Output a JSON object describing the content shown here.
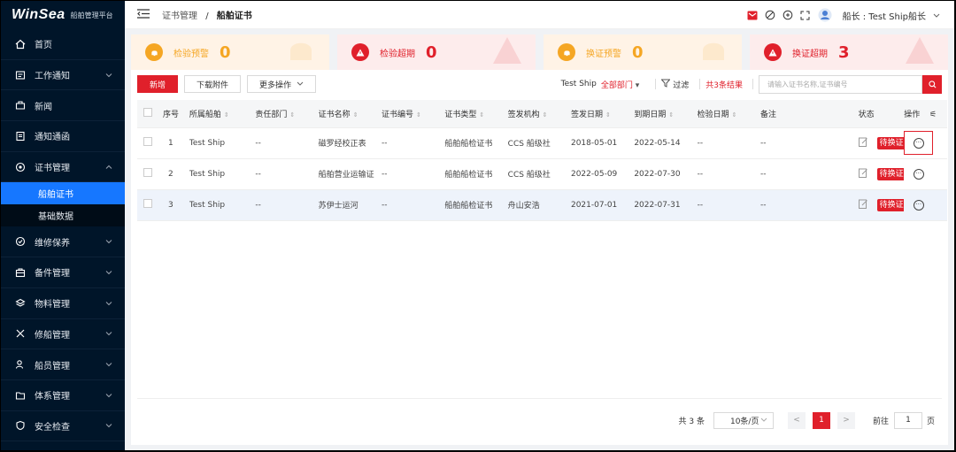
{
  "logo": {
    "brand": "WinSea",
    "subtitle": "船舶管理平台"
  },
  "sidebar": {
    "items": [
      {
        "label": "首页",
        "icon": "home-icon"
      },
      {
        "label": "工作通知",
        "icon": "notice-icon"
      },
      {
        "label": "新闻",
        "icon": "news-icon"
      },
      {
        "label": "通知通函",
        "icon": "circular-icon"
      },
      {
        "label": "证书管理",
        "icon": "certificate-icon"
      },
      {
        "label": "维修保养",
        "icon": "maintenance-icon"
      },
      {
        "label": "备件管理",
        "icon": "spare-parts-icon"
      },
      {
        "label": "物料管理",
        "icon": "material-icon"
      },
      {
        "label": "修船管理",
        "icon": "repair-icon"
      },
      {
        "label": "船员管理",
        "icon": "crew-icon"
      },
      {
        "label": "体系管理",
        "icon": "system-icon"
      },
      {
        "label": "安全检查",
        "icon": "safety-icon"
      }
    ],
    "sub": [
      {
        "label": "船舶证书"
      },
      {
        "label": "基础数据"
      }
    ]
  },
  "header": {
    "crumb_parent": "证书管理",
    "crumb_sep": "/",
    "crumb_current": "船舶证书",
    "user": "船长 : Test Ship船长"
  },
  "cards": [
    {
      "label": "检验预警",
      "value": "0",
      "color": "#f5a623"
    },
    {
      "label": "检验超期",
      "value": "0",
      "color": "#e0202b"
    },
    {
      "label": "换证预警",
      "value": "0",
      "color": "#f5a623"
    },
    {
      "label": "换证超期",
      "value": "3",
      "color": "#e0202b"
    }
  ],
  "toolbar": {
    "add": "新增",
    "download": "下载附件",
    "more": "更多操作",
    "ship": "Test Ship",
    "dept": "全部部门",
    "filter": "过滤",
    "count": "共3条结果",
    "search_placeholder": "请输入证书名称,证书编号"
  },
  "table": {
    "headers": [
      "序号",
      "所属船舶",
      "责任部门",
      "证书名称",
      "证书编号",
      "证书类型",
      "签发机构",
      "签发日期",
      "到期日期",
      "检验日期",
      "备注",
      "状态",
      "操作"
    ],
    "rows": [
      {
        "no": "1",
        "ship": "Test Ship",
        "dept": "--",
        "name": "磁罗经校正表",
        "code": "--",
        "type": "船舶船检证书",
        "org": "CCS 船级社",
        "issue": "2018-05-01",
        "expire": "2022-05-14",
        "inspect": "--",
        "remark": "--",
        "status": "待换证"
      },
      {
        "no": "2",
        "ship": "Test Ship",
        "dept": "--",
        "name": "船舶营业运输证",
        "code": "--",
        "type": "船舶船检证书",
        "org": "CCS 船级社",
        "issue": "2022-05-09",
        "expire": "2022-07-30",
        "inspect": "--",
        "remark": "--",
        "status": "待换证"
      },
      {
        "no": "3",
        "ship": "Test Ship",
        "dept": "--",
        "name": "苏伊士运河",
        "code": "--",
        "type": "船舶船检证书",
        "org": "舟山安浩",
        "issue": "2021-07-01",
        "expire": "2022-07-31",
        "inspect": "--",
        "remark": "--",
        "status": "待换证"
      }
    ]
  },
  "pager": {
    "total": "共 3 条",
    "size": "10条/页",
    "prev": "<",
    "page": "1",
    "next": ">",
    "goto": "前往",
    "goto_value": "1",
    "page_unit": "页"
  },
  "colors": {
    "accent": "#e0202b",
    "sidebar": "#001529",
    "active": "#1677ff",
    "warn": "#f5a623"
  }
}
